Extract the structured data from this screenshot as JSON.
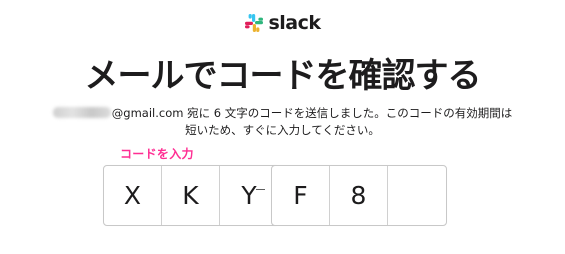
{
  "logo": {
    "word": "slack",
    "icon": "slack-logo-icon",
    "colors": [
      "#e01e5a",
      "#36c5f0",
      "#2eb67d",
      "#ecb22e"
    ]
  },
  "title": "メールでコードを確認する",
  "description": {
    "email_domain": "@gmail.com",
    "line1_rest": " 宛に 6 文字のコードを送信しました。このコードの有効期間は",
    "line2": "短いため、すぐに入力してください。"
  },
  "annotation": "コードを入力",
  "code": {
    "first_group": [
      "X",
      "K",
      "Y"
    ],
    "second_group": [
      "F",
      "8",
      ""
    ]
  },
  "colors": {
    "annotation": "#ff2e93",
    "text": "#1d1c1d",
    "box_border": "#c8c8c8"
  }
}
